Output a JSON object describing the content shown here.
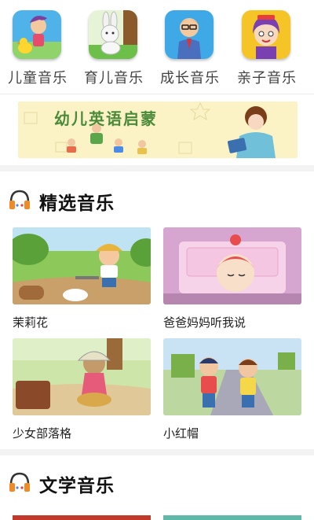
{
  "categories": [
    {
      "label": "儿童音乐",
      "icon": "child-music-icon"
    },
    {
      "label": "育儿音乐",
      "icon": "parenting-music-icon"
    },
    {
      "label": "成长音乐",
      "icon": "growth-music-icon"
    },
    {
      "label": "亲子音乐",
      "icon": "family-music-icon"
    }
  ],
  "banner": {
    "text": "幼儿英语启蒙"
  },
  "sections": [
    {
      "title": "精选音乐",
      "icon": "headphones-icon",
      "items": [
        {
          "title": "茉莉花"
        },
        {
          "title": "爸爸妈妈听我说"
        },
        {
          "title": "少女部落格"
        },
        {
          "title": "小红帽"
        }
      ]
    },
    {
      "title": "文学音乐",
      "icon": "headphones-icon"
    }
  ],
  "colors": {
    "icon_bg_1": "#4fb3ea",
    "icon_bg_2": "#6cc04a",
    "icon_bg_3": "#3fa9e8",
    "icon_bg_4": "#f5c426",
    "headphones_accent": "#f08a24"
  }
}
